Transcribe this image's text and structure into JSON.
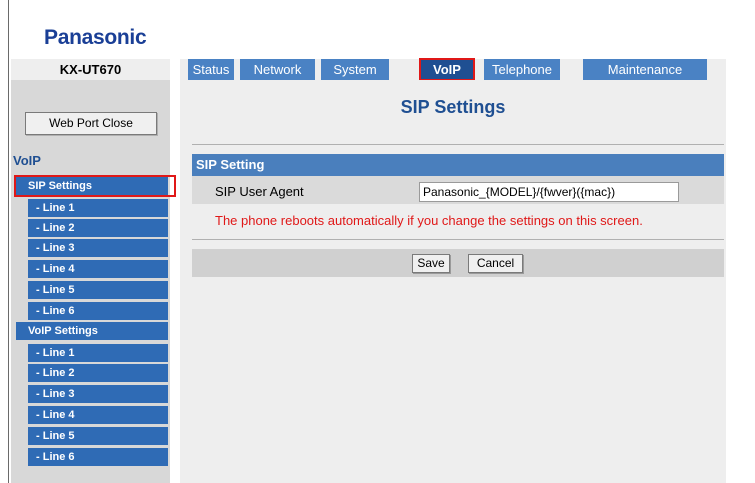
{
  "brand": {
    "logo": "Panasonic",
    "model": "KX-UT670"
  },
  "tabs": [
    "Status",
    "Network",
    "System",
    "VoIP",
    "Telephone",
    "Maintenance"
  ],
  "active_tab": "VoIP",
  "web_port_close": "Web Port Close",
  "sidebar": {
    "section": "VoIP",
    "sip_settings": "SIP Settings",
    "sip_lines": [
      "- Line 1",
      "- Line 2",
      "- Line 3",
      "- Line 4",
      "- Line 5",
      "- Line 6"
    ],
    "voip_settings": "VoIP Settings",
    "voip_lines": [
      "- Line 1",
      "- Line 2",
      "- Line 3",
      "- Line 4",
      "- Line 5",
      "- Line 6"
    ]
  },
  "page": {
    "title": "SIP Settings",
    "section_header": "SIP Setting",
    "sip_user_agent_label": "SIP User Agent",
    "sip_user_agent_value": "Panasonic_{MODEL}/{fwver}({mac})",
    "warning": "The phone reboots automatically if you change the settings on this screen.",
    "save": "Save",
    "cancel": "Cancel"
  },
  "colors": {
    "nav_blue": "#4a82c4",
    "dark_blue": "#1f4f92",
    "highlight_red": "#e01818",
    "warning_red": "#e01818"
  }
}
